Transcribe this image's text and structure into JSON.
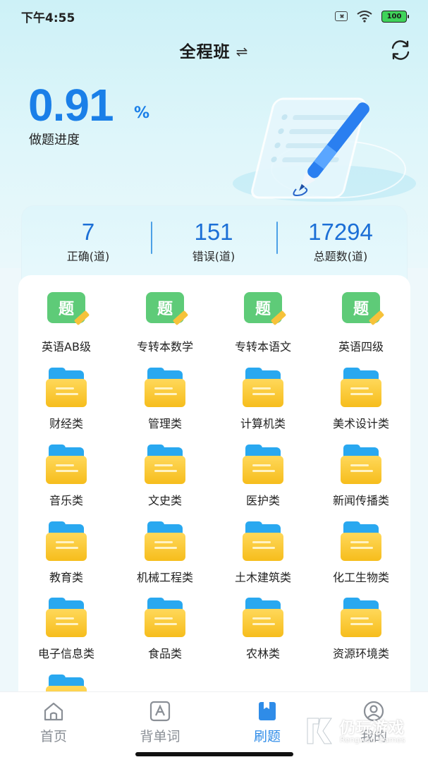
{
  "status_bar": {
    "time": "下午4:55",
    "battery": "100"
  },
  "header": {
    "title": "全程班",
    "swap_glyph": "⇌"
  },
  "progress": {
    "value": "0.91",
    "unit": "%",
    "label": "做题进度"
  },
  "stats": [
    {
      "value": "7",
      "label": "正确(道)"
    },
    {
      "value": "151",
      "label": "错误(道)"
    },
    {
      "value": "17294",
      "label": "总题数(道)"
    }
  ],
  "categories": [
    {
      "label": "英语AB级",
      "icon": "question-book-icon",
      "icon_text": "题"
    },
    {
      "label": "专转本数学",
      "icon": "question-book-icon",
      "icon_text": "题"
    },
    {
      "label": "专转本语文",
      "icon": "question-book-icon",
      "icon_text": "题"
    },
    {
      "label": "英语四级",
      "icon": "question-book-icon",
      "icon_text": "题"
    },
    {
      "label": "财经类",
      "icon": "folder-icon"
    },
    {
      "label": "管理类",
      "icon": "folder-icon"
    },
    {
      "label": "计算机类",
      "icon": "folder-icon"
    },
    {
      "label": "美术设计类",
      "icon": "folder-icon"
    },
    {
      "label": "音乐类",
      "icon": "folder-icon"
    },
    {
      "label": "文史类",
      "icon": "folder-icon"
    },
    {
      "label": "医护类",
      "icon": "folder-icon"
    },
    {
      "label": "新闻传播类",
      "icon": "folder-icon"
    },
    {
      "label": "教育类",
      "icon": "folder-icon"
    },
    {
      "label": "机械工程类",
      "icon": "folder-icon"
    },
    {
      "label": "土木建筑类",
      "icon": "folder-icon"
    },
    {
      "label": "化工生物类",
      "icon": "folder-icon"
    },
    {
      "label": "电子信息类",
      "icon": "folder-icon"
    },
    {
      "label": "食品类",
      "icon": "folder-icon"
    },
    {
      "label": "农林类",
      "icon": "folder-icon"
    },
    {
      "label": "资源环境类",
      "icon": "folder-icon"
    },
    {
      "label": "",
      "icon": "folder-icon"
    }
  ],
  "bottom_nav": [
    {
      "label": "首页",
      "icon": "home-icon",
      "active": false
    },
    {
      "label": "背单词",
      "icon": "word-card-icon",
      "active": false
    },
    {
      "label": "刷题",
      "icon": "practice-book-icon",
      "active": true
    },
    {
      "label": "我的",
      "icon": "profile-icon",
      "active": false
    }
  ],
  "watermark": {
    "title": "仍玩游戏",
    "subtitle": "Rengwan Games"
  },
  "colors": {
    "accent": "#1a7fe8",
    "active_nav": "#2f8ce8",
    "question_green": "#5ecb78",
    "folder_yellow": "#f6bd1c",
    "folder_blue": "#29a8f0"
  }
}
